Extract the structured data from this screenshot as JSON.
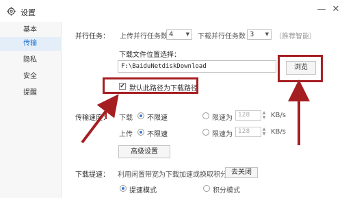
{
  "window": {
    "title": "设置",
    "minimize": "—",
    "close": "✕"
  },
  "sidebar": {
    "items": [
      {
        "label": "基本",
        "active": false
      },
      {
        "label": "传输",
        "active": true
      },
      {
        "label": "隐私",
        "active": false
      },
      {
        "label": "安全",
        "active": false
      },
      {
        "label": "提醒",
        "active": false
      }
    ]
  },
  "parallel": {
    "label": "并行任务：",
    "upload_label": "上传并行任务数",
    "upload_value": "4",
    "download_label": "下载并行任务数",
    "download_value": "3",
    "hint": "（推荐智能）"
  },
  "download_location": {
    "label": "下载文件位置选择：",
    "path": "F:\\BaiduNetdiskDownload",
    "browse_button": "浏览",
    "default_checkbox_label": "默认此路径为下载路径",
    "default_checked": true
  },
  "speed": {
    "label": "传输速度：",
    "download_label": "下载",
    "upload_label": "上传",
    "unlimited_label": "不限速",
    "limited_label": "限速为",
    "download_limit_value": "128",
    "upload_limit_value": "128",
    "unit": "KB/s",
    "advanced_button": "高级设置"
  },
  "acceleration": {
    "label": "下载提速：",
    "description": "利用闲置带宽为下载加速或换取积分",
    "close_button": "去关闭",
    "option_speedup": "提速模式",
    "option_points": "积分模式"
  },
  "colors": {
    "annotation_red": "#a51e22",
    "accent_blue": "#1c6fd1",
    "radio_blue": "#3a7bd5"
  },
  "icons": [
    "gear-icon",
    "minimize-icon",
    "close-icon",
    "checkbox-icon",
    "radio-icon",
    "spinner-icon"
  ]
}
